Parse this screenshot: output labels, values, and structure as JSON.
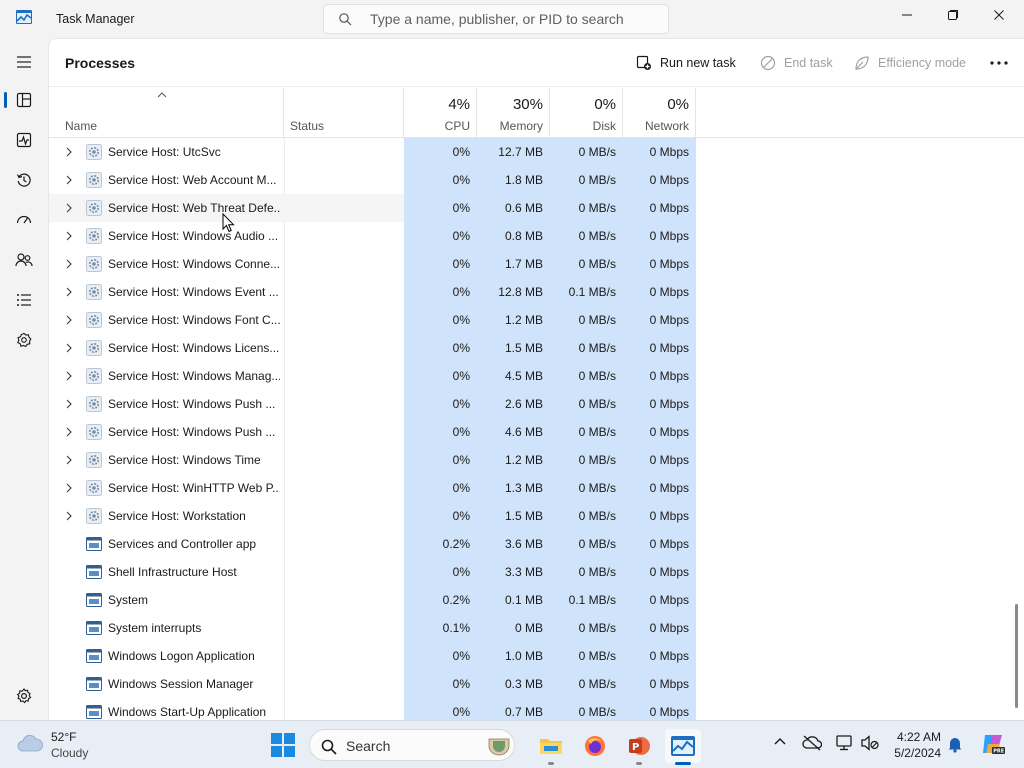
{
  "window": {
    "title": "Task Manager",
    "search_placeholder": "Type a name, publisher, or PID to search"
  },
  "nav": {
    "items": [
      {
        "name": "processes",
        "icon": "processes-icon",
        "active": true
      },
      {
        "name": "performance",
        "icon": "performance-icon"
      },
      {
        "name": "app-history",
        "icon": "app-history-icon"
      },
      {
        "name": "startup-apps",
        "icon": "startup-apps-icon"
      },
      {
        "name": "users",
        "icon": "users-icon"
      },
      {
        "name": "details",
        "icon": "details-icon"
      },
      {
        "name": "services",
        "icon": "services-icon"
      }
    ],
    "settings_icon": "gear-icon"
  },
  "toolbar": {
    "page_title": "Processes",
    "run_new_task": "Run new task",
    "end_task": "End task",
    "efficiency_mode": "Efficiency mode",
    "more_icon": "more-icon"
  },
  "columns": {
    "name": "Name",
    "status": "Status",
    "cpu": {
      "label": "CPU",
      "pct": "4%"
    },
    "memory": {
      "label": "Memory",
      "pct": "30%"
    },
    "disk": {
      "label": "Disk",
      "pct": "0%"
    },
    "network": {
      "label": "Network",
      "pct": "0%"
    }
  },
  "colors": {
    "usage_shade": "#cfe4fa",
    "accent": "#005fb8"
  },
  "processes": [
    {
      "name": "Service Host: UtcSvc",
      "cpu": "0%",
      "memory": "12.7 MB",
      "disk": "0 MB/s",
      "network": "0 Mbps",
      "expandable": true
    },
    {
      "name": "Service Host: Web Account M...",
      "cpu": "0%",
      "memory": "1.8 MB",
      "disk": "0 MB/s",
      "network": "0 Mbps",
      "expandable": true
    },
    {
      "name": "Service Host: Web Threat Defe...",
      "cpu": "0%",
      "memory": "0.6 MB",
      "disk": "0 MB/s",
      "network": "0 Mbps",
      "expandable": true,
      "hover": true
    },
    {
      "name": "Service Host: Windows Audio ...",
      "cpu": "0%",
      "memory": "0.8 MB",
      "disk": "0 MB/s",
      "network": "0 Mbps",
      "expandable": true
    },
    {
      "name": "Service Host: Windows Conne...",
      "cpu": "0%",
      "memory": "1.7 MB",
      "disk": "0 MB/s",
      "network": "0 Mbps",
      "expandable": true
    },
    {
      "name": "Service Host: Windows Event ...",
      "cpu": "0%",
      "memory": "12.8 MB",
      "disk": "0.1 MB/s",
      "network": "0 Mbps",
      "expandable": true
    },
    {
      "name": "Service Host: Windows Font C...",
      "cpu": "0%",
      "memory": "1.2 MB",
      "disk": "0 MB/s",
      "network": "0 Mbps",
      "expandable": true
    },
    {
      "name": "Service Host: Windows Licens...",
      "cpu": "0%",
      "memory": "1.5 MB",
      "disk": "0 MB/s",
      "network": "0 Mbps",
      "expandable": true
    },
    {
      "name": "Service Host: Windows Manag...",
      "cpu": "0%",
      "memory": "4.5 MB",
      "disk": "0 MB/s",
      "network": "0 Mbps",
      "expandable": true
    },
    {
      "name": "Service Host: Windows Push ...",
      "cpu": "0%",
      "memory": "2.6 MB",
      "disk": "0 MB/s",
      "network": "0 Mbps",
      "expandable": true
    },
    {
      "name": "Service Host: Windows Push ...",
      "cpu": "0%",
      "memory": "4.6 MB",
      "disk": "0 MB/s",
      "network": "0 Mbps",
      "expandable": true
    },
    {
      "name": "Service Host: Windows Time",
      "cpu": "0%",
      "memory": "1.2 MB",
      "disk": "0 MB/s",
      "network": "0 Mbps",
      "expandable": true
    },
    {
      "name": "Service Host: WinHTTP Web P...",
      "cpu": "0%",
      "memory": "1.3 MB",
      "disk": "0 MB/s",
      "network": "0 Mbps",
      "expandable": true
    },
    {
      "name": "Service Host: Workstation",
      "cpu": "0%",
      "memory": "1.5 MB",
      "disk": "0 MB/s",
      "network": "0 Mbps",
      "expandable": true
    },
    {
      "name": "Services and Controller app",
      "cpu": "0.2%",
      "memory": "3.6 MB",
      "disk": "0 MB/s",
      "network": "0 Mbps",
      "expandable": false
    },
    {
      "name": "Shell Infrastructure Host",
      "cpu": "0%",
      "memory": "3.3 MB",
      "disk": "0 MB/s",
      "network": "0 Mbps",
      "expandable": false
    },
    {
      "name": "System",
      "cpu": "0.2%",
      "memory": "0.1 MB",
      "disk": "0.1 MB/s",
      "network": "0 Mbps",
      "expandable": false
    },
    {
      "name": "System interrupts",
      "cpu": "0.1%",
      "memory": "0 MB",
      "disk": "0 MB/s",
      "network": "0 Mbps",
      "expandable": false
    },
    {
      "name": "Windows Logon Application",
      "cpu": "0%",
      "memory": "1.0 MB",
      "disk": "0 MB/s",
      "network": "0 Mbps",
      "expandable": false
    },
    {
      "name": "Windows Session Manager",
      "cpu": "0%",
      "memory": "0.3 MB",
      "disk": "0 MB/s",
      "network": "0 Mbps",
      "expandable": false
    },
    {
      "name": "Windows Start-Up Application",
      "cpu": "0%",
      "memory": "0.7 MB",
      "disk": "0 MB/s",
      "network": "0 Mbps",
      "expandable": false
    }
  ],
  "taskbar": {
    "weather_temp": "52°F",
    "weather_condition": "Cloudy",
    "search_label": "Search",
    "apps": [
      {
        "name": "file-explorer",
        "icon": "folder-icon",
        "active": false
      },
      {
        "name": "firefox",
        "icon": "firefox-icon",
        "active": false
      },
      {
        "name": "powerpoint",
        "icon": "powerpoint-icon",
        "active": false
      },
      {
        "name": "task-manager",
        "icon": "task-manager-icon",
        "active": true
      }
    ],
    "time": "4:22 AM",
    "date": "5/2/2024"
  }
}
